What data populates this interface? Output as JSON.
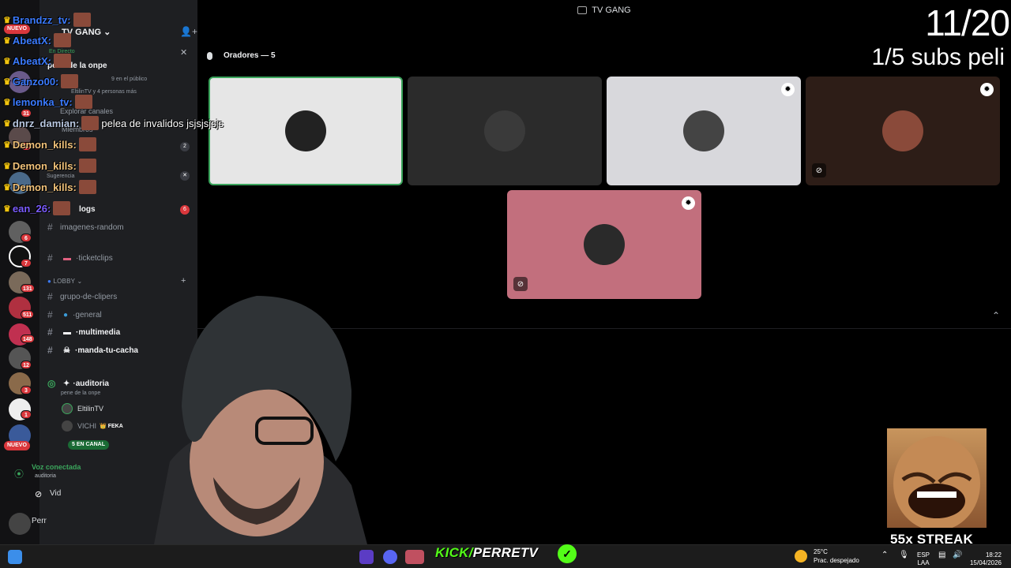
{
  "window": {
    "title": "TV GANG"
  },
  "overlay": {
    "goal": "11/20",
    "subs": "1/5 subs peli",
    "streak": "55x STREAK"
  },
  "rail": {
    "nuevo_top": "NUEVO",
    "nuevo_bottom": "NUEVO",
    "badges": [
      "31",
      "8",
      "6",
      "7",
      "131",
      "511",
      "148",
      "12",
      "3",
      "1"
    ]
  },
  "sidebar": {
    "server_name": "TV GANG",
    "live_label": "En Directo",
    "stage_name": "pene de la onpe",
    "audience": "9 en el público",
    "audience_people": "EltilinTV y 4 personas más",
    "explore": "Explorar canales",
    "members": "Miembros",
    "suggestion": "Sugerencia",
    "suggestion_badge": "2",
    "channels": [
      {
        "name": "logs",
        "badge": "6"
      },
      {
        "name": "imagenes-random"
      },
      {
        "name": "ticketclips"
      }
    ],
    "category_lobby": "LOBBY",
    "lobby_channels": [
      "grupo-de-clipers",
      "general",
      "multimedia",
      "manda-tu-cacha"
    ],
    "voice_channel": "auditoria",
    "voice_subtitle": "pene de la onpe",
    "voice_users": [
      {
        "name": "EltilinTV"
      },
      {
        "name": "VICHI",
        "tag": "FEKA"
      }
    ],
    "in_channel": "5 EN CANAL",
    "voice_connected": "Voz conectada",
    "voice_connected_sub": "auditoria",
    "video_label": "Vid",
    "user_label": "Perr"
  },
  "stage": {
    "speakers_label": "Oradores — 5",
    "speakers": [
      {
        "bg": "#e6e6e6",
        "highlight": true,
        "badge": false,
        "muted": false
      },
      {
        "bg": "#2b2b2b",
        "highlight": false,
        "badge": false,
        "muted": false
      },
      {
        "bg": "#d8d8dc",
        "highlight": false,
        "badge": true,
        "muted": false
      },
      {
        "bg": "#2d1d17",
        "highlight": false,
        "badge": true,
        "muted": true
      },
      {
        "bg": "#c26f7d",
        "highlight": false,
        "badge": true,
        "muted": true
      }
    ]
  },
  "chat": [
    {
      "user": "Brandzz_tv:",
      "color": "#3b7bff",
      "emote": true,
      "msg": ""
    },
    {
      "user": "AbeatX:",
      "color": "#3b7bff",
      "emote": true,
      "msg": ""
    },
    {
      "user": "AbeatX:",
      "color": "#3b7bff",
      "emote": true,
      "msg": ""
    },
    {
      "user": "Ganzo00:",
      "color": "#3b7bff",
      "emote": true,
      "msg": ""
    },
    {
      "user": "lemonka_tv:",
      "color": "#3b7bff",
      "emote": true,
      "msg": ""
    },
    {
      "user": "dnrz_damian:",
      "color": "#b8c7e0",
      "emote": true,
      "msg": "pelea de invalidos jsjsjsjsjs"
    },
    {
      "user": "Demon_kills:",
      "color": "#f1c27a",
      "emote": true,
      "msg": ""
    },
    {
      "user": "Demon_kills:",
      "color": "#f1c27a",
      "emote": true,
      "msg": ""
    },
    {
      "user": "Demon_kills:",
      "color": "#f1c27a",
      "emote": true,
      "msg": ""
    },
    {
      "user": "ean_26:",
      "color": "#7b5cff",
      "emote": true,
      "msg": ""
    }
  ],
  "taskbar": {
    "brand_green": "KICK/",
    "brand_white": "PERRETV",
    "temp": "25°C",
    "weather": "Prac. despejado",
    "lang": "ESP",
    "lang_sub": "LAA",
    "time": "18:22",
    "date": "15/04/2026"
  },
  "colors": {
    "kick_green": "#53fc18",
    "discord_bg": "#1e1f22",
    "badge_red": "#da373c"
  }
}
